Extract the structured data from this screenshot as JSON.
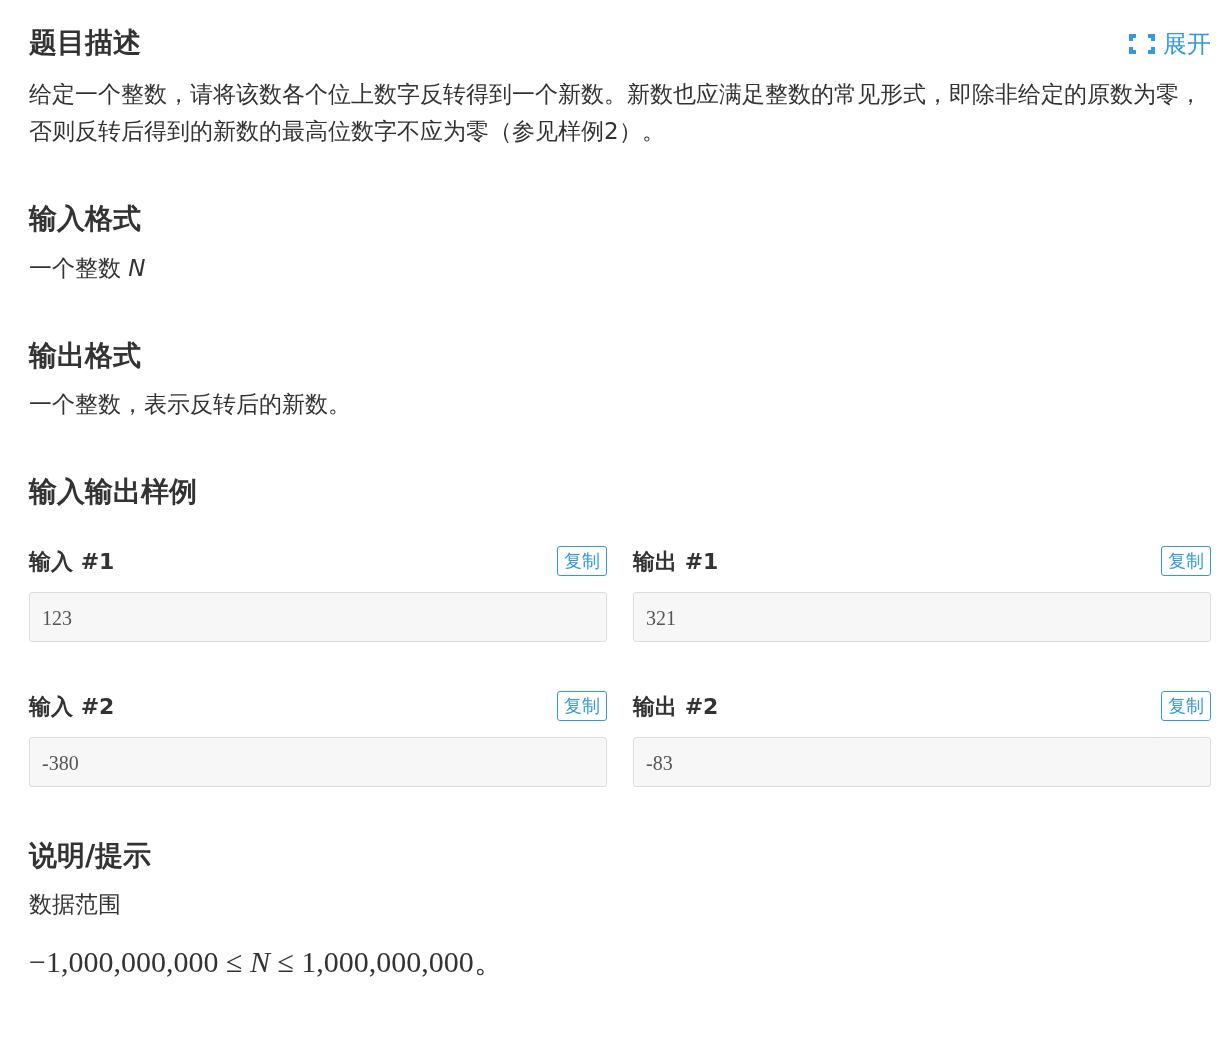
{
  "header": {
    "title": "题目描述",
    "expand_label": "展开"
  },
  "sections": [
    {
      "kind": "text",
      "paragraphs": [
        {
          "kind": "text",
          "text": "给定一个整数，请将该数各个位上数字反转得到一个新数。新数也应满足整数的常见形式，即除非给定的原数为零，否则反转后得到的新数的最高位数字不应为零（参见样例2）。"
        }
      ]
    },
    {
      "kind": "text",
      "title": "输入格式",
      "paragraphs": [
        {
          "kind": "text",
          "text": "一个整数 *N*"
        }
      ]
    },
    {
      "kind": "text",
      "title": "输出格式",
      "paragraphs": [
        {
          "kind": "text",
          "text": "一个整数，表示反转后的新数。"
        }
      ]
    },
    {
      "kind": "samples",
      "title": "输入输出样例",
      "samples": [
        {
          "input_label": "输入 #1",
          "output_label": "输出 #1",
          "input": "123",
          "output": "321",
          "input_copy_label": "复制",
          "output_copy_label": "复制"
        },
        {
          "input_label": "输入 #2",
          "output_label": "输出 #2",
          "input": "-380",
          "output": "-83",
          "input_copy_label": "复制",
          "output_copy_label": "复制"
        }
      ]
    },
    {
      "kind": "text",
      "title": "说明/提示",
      "paragraphs": [
        {
          "kind": "text",
          "text": "数据范围"
        },
        {
          "kind": "math",
          "text": "−1,000,000,000 ≤ *N* ≤ 1,000,000,000。"
        }
      ]
    }
  ]
}
